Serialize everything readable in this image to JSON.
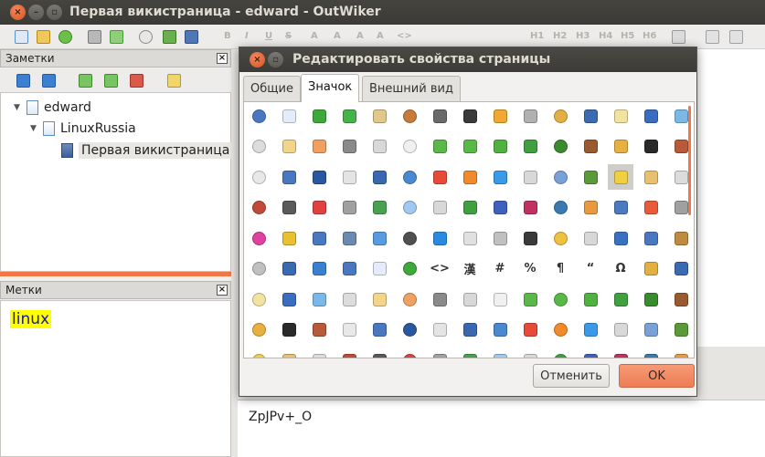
{
  "window": {
    "title": "Первая викистраница - edward - OutWiker",
    "close_glyph": "×",
    "min_glyph": "–",
    "max_glyph": "▫"
  },
  "toolbar": {
    "format_buttons": [
      "B",
      "I",
      "U",
      "S",
      "A",
      "A",
      "A",
      "A",
      "<>",
      "H1",
      "H2",
      "H3",
      "H4",
      "H5",
      "H6"
    ]
  },
  "notes_pane": {
    "title": "Заметки",
    "close_glyph": "×"
  },
  "tree": [
    {
      "label": "edward",
      "arrow": "▼"
    },
    {
      "label": "LinuxRussia",
      "arrow": "▼"
    },
    {
      "label": "Первая викистраница",
      "arrow": ""
    }
  ],
  "tags_pane": {
    "title": "Метки",
    "close_glyph": "×",
    "tags": [
      "linux"
    ]
  },
  "preview": {
    "text": "ZpJPv+_O"
  },
  "dialog": {
    "title": "Редактировать свойства страницы",
    "close_glyph": "×",
    "max_glyph": "▫",
    "tabs": [
      {
        "label": "Общие",
        "active": false
      },
      {
        "label": "Значок",
        "active": true
      },
      {
        "label": "Внешний вид",
        "active": false
      }
    ],
    "cancel_label": "Отменить",
    "ok_label": "OK"
  },
  "icon_glyphs": [
    "<>",
    "漢",
    "#",
    "%",
    "¶",
    "“",
    "Ω"
  ],
  "colors": {
    "accent": "#f07746",
    "titlebar": "#3c3b37",
    "ok_button": "#ee7d54"
  }
}
